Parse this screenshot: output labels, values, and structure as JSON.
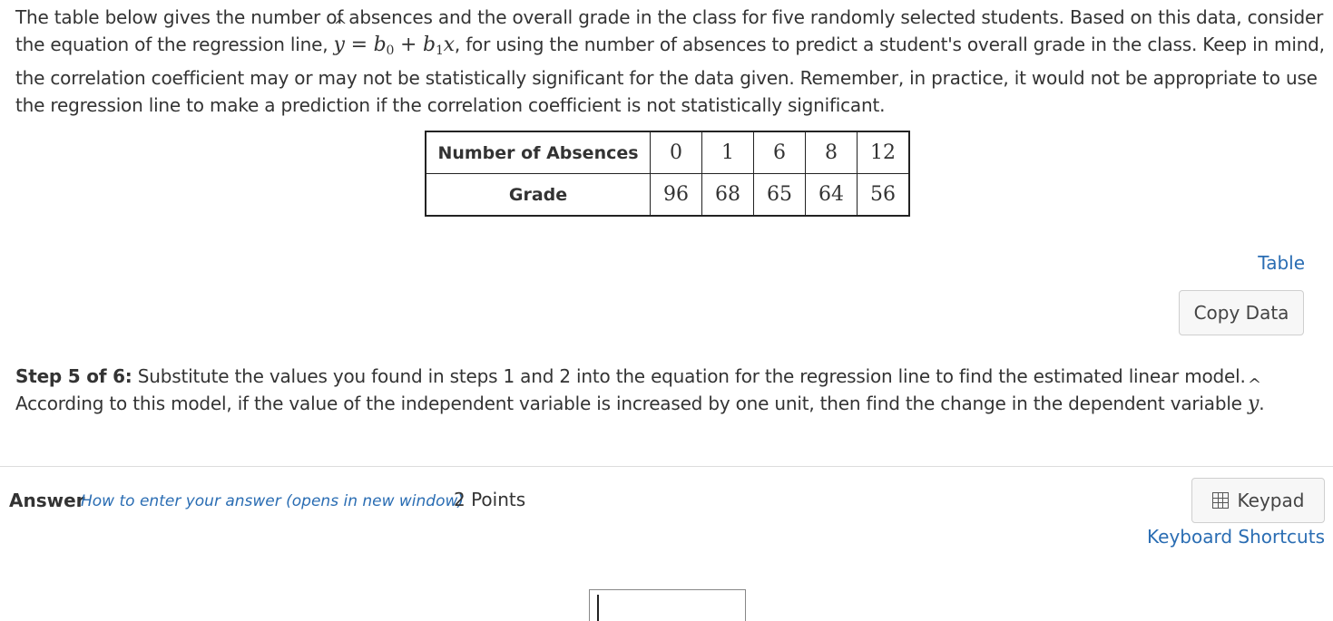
{
  "intro": {
    "text1": "The table below gives the number of absences and the overall grade in the class for five randomly selected students. Based on this data, consider the equation of the regression line, ",
    "eq_yhat": "y",
    "eq_rest": " = b",
    "eq_b0_sub": "0",
    "eq_plus": " + b",
    "eq_b1_sub": "1",
    "eq_x": "x",
    "text2": ", for using the number of absences to predict a student's overall grade in the class. Keep in mind, the correlation coefficient may or may not be statistically significant for the data given. Remember, in practice, it would not be appropriate to use the regression line to make a prediction if the correlation coefficient is not statistically significant."
  },
  "table": {
    "row1_header": "Number of Absences",
    "row1_values": [
      "0",
      "1",
      "6",
      "8",
      "12"
    ],
    "row2_header": "Grade",
    "row2_values": [
      "96",
      "68",
      "65",
      "64",
      "56"
    ]
  },
  "links": {
    "table": "Table",
    "copy_data": "Copy Data",
    "how_to": "How to enter your answer (opens in new window)",
    "keypad": "Keypad",
    "keyboard_shortcuts": "Keyboard Shortcuts"
  },
  "step": {
    "label": "Step 5 of 6:",
    "text": " Substitute the values you found in steps 1 and 2 into the equation for the regression line to find the estimated linear model. According to this model, if the value of the independent variable is increased by one unit, then find the change in the dependent variable ",
    "yhat": "y",
    "end": "."
  },
  "answer": {
    "label": "Answer",
    "points": "2 Points",
    "value": ""
  },
  "icons": {
    "keypad": "keypad-icon"
  }
}
